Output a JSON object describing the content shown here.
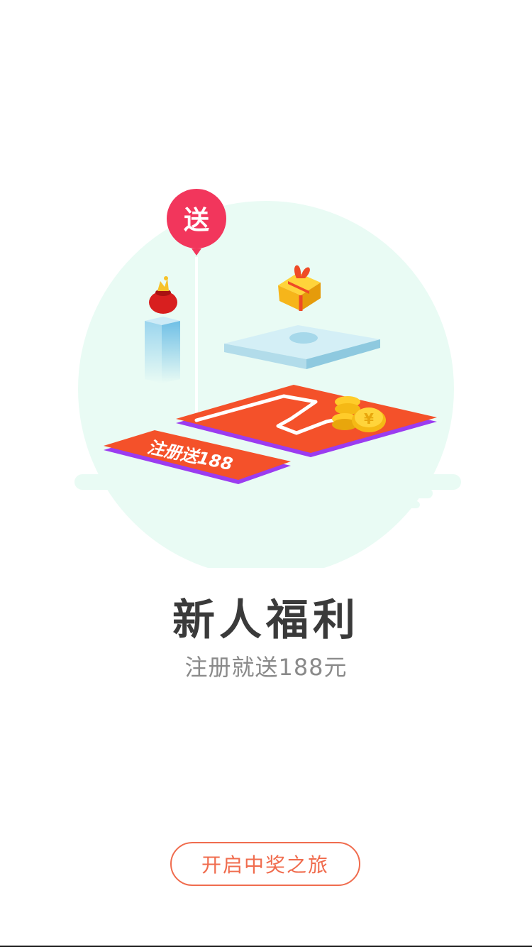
{
  "colors": {
    "accent": "#f06c4e",
    "title": "#3a3a3a",
    "subtitle": "#8a8a8a",
    "bg_circle": "#e9fbf4",
    "balloon": "#f2365c",
    "card_red": "#f4512a",
    "card_purple": "#9b3cf0"
  },
  "illustration": {
    "balloon_text": "送",
    "card_text": "注册送188"
  },
  "content": {
    "title": "新人福利",
    "subtitle": "注册就送188元"
  },
  "cta": {
    "label": "开启中奖之旅"
  },
  "icons": [
    "balloon-icon",
    "red-pouch-icon",
    "gift-box-icon",
    "coin-stack-icon"
  ]
}
